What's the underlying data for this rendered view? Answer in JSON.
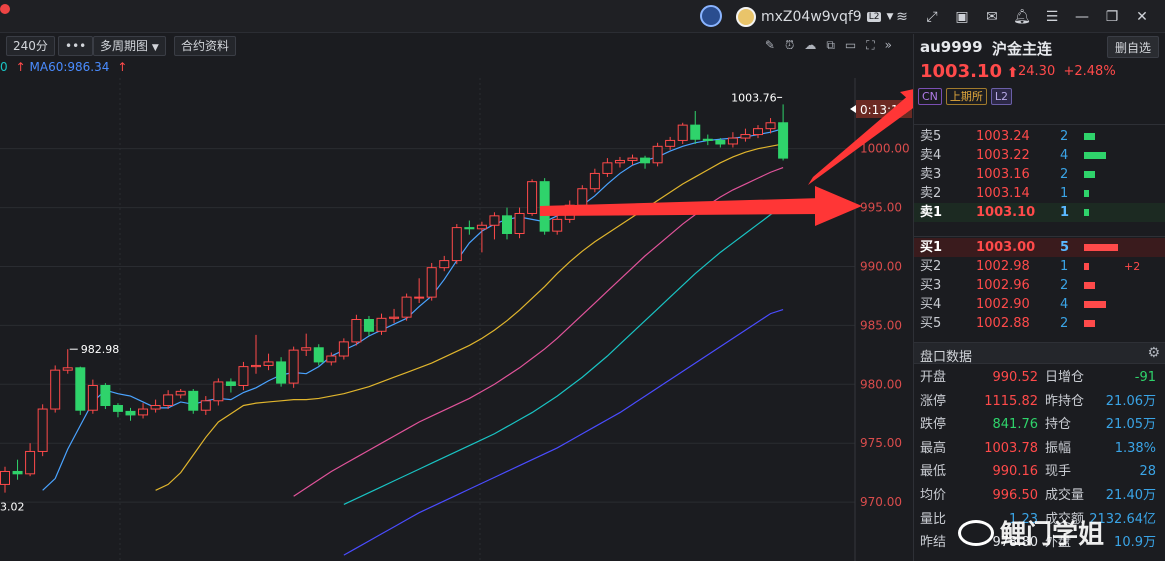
{
  "topbar": {
    "username": "mxZ04w9vqf9",
    "level_badge": "L2",
    "icons": [
      "robot-icon",
      "layers-icon",
      "expand-icon",
      "ticket-icon",
      "mail-icon",
      "bell-icon",
      "menu-icon",
      "minimize-icon",
      "restore-icon",
      "close-icon"
    ]
  },
  "toolbar": {
    "period": "240分",
    "more": "•••",
    "multi_period": "多周期图",
    "contract_info": "合约资料"
  },
  "ma_legend": {
    "ma60": "MA60:986.34"
  },
  "chart_data": {
    "type": "candlestick",
    "y_ticks": [
      "1000.00",
      "995.00",
      "990.00",
      "985.00",
      "980.00",
      "975.00",
      "970.00"
    ],
    "ylim": [
      965,
      1006
    ],
    "high_label": "1003.76",
    "low_label": "982.98",
    "left_low_label": "3.02",
    "countdown": "0:13:11",
    "candles": [
      [
        971.5,
        972.6,
        970.8,
        973.0
      ],
      [
        972.6,
        972.4,
        971.9,
        973.6
      ],
      [
        972.4,
        974.3,
        972.2,
        975.0
      ],
      [
        974.3,
        977.9,
        973.9,
        978.3
      ],
      [
        977.9,
        981.2,
        977.6,
        981.6
      ],
      [
        981.2,
        981.4,
        980.9,
        982.98
      ],
      [
        981.4,
        977.8,
        977.4,
        981.5
      ],
      [
        977.8,
        979.9,
        977.5,
        980.4
      ],
      [
        979.9,
        978.2,
        977.9,
        980.1
      ],
      [
        978.2,
        977.7,
        977.2,
        978.4
      ],
      [
        977.7,
        977.4,
        976.9,
        978.0
      ],
      [
        977.4,
        977.9,
        977.1,
        978.4
      ],
      [
        977.9,
        978.2,
        977.6,
        978.7
      ],
      [
        978.2,
        979.1,
        977.9,
        979.5
      ],
      [
        979.1,
        979.4,
        978.8,
        979.6
      ],
      [
        979.4,
        977.8,
        977.5,
        979.6
      ],
      [
        977.8,
        978.6,
        977.4,
        979.0
      ],
      [
        978.6,
        980.2,
        978.2,
        980.5
      ],
      [
        980.2,
        979.9,
        979.3,
        980.5
      ],
      [
        979.9,
        981.5,
        979.5,
        981.9
      ],
      [
        981.5,
        981.6,
        980.9,
        984.2
      ],
      [
        981.6,
        981.9,
        981.2,
        982.6
      ],
      [
        981.9,
        980.1,
        979.8,
        982.3
      ],
      [
        980.1,
        982.9,
        979.7,
        983.2
      ],
      [
        982.9,
        983.1,
        982.4,
        984.3
      ],
      [
        983.1,
        981.9,
        981.6,
        983.4
      ],
      [
        981.9,
        982.4,
        981.6,
        982.7
      ],
      [
        982.4,
        983.6,
        982.1,
        983.9
      ],
      [
        983.6,
        985.5,
        983.3,
        985.9
      ],
      [
        985.5,
        984.5,
        984.1,
        985.8
      ],
      [
        984.5,
        985.6,
        984.2,
        986.0
      ],
      [
        985.6,
        985.7,
        985.2,
        986.4
      ],
      [
        985.7,
        987.4,
        985.4,
        987.7
      ],
      [
        987.4,
        987.4,
        986.9,
        989.0
      ],
      [
        987.4,
        989.9,
        987.1,
        990.3
      ],
      [
        989.9,
        990.5,
        989.6,
        990.9
      ],
      [
        990.5,
        993.3,
        990.2,
        993.6
      ],
      [
        993.3,
        993.2,
        992.7,
        993.9
      ],
      [
        993.2,
        993.5,
        991.2,
        993.8
      ],
      [
        993.5,
        994.3,
        992.3,
        994.6
      ],
      [
        994.3,
        992.8,
        992.3,
        995.0
      ],
      [
        992.8,
        994.5,
        992.4,
        995.0
      ],
      [
        994.5,
        997.2,
        994.3,
        997.4
      ],
      [
        997.2,
        993.0,
        992.7,
        997.5
      ],
      [
        993.0,
        994.0,
        992.7,
        994.3
      ],
      [
        994.0,
        995.2,
        993.7,
        995.6
      ],
      [
        995.2,
        996.6,
        994.9,
        996.9
      ],
      [
        996.6,
        997.9,
        996.3,
        998.3
      ],
      [
        997.9,
        998.8,
        997.6,
        999.2
      ],
      [
        998.8,
        999.0,
        998.4,
        999.3
      ],
      [
        999.0,
        999.2,
        998.6,
        999.5
      ],
      [
        999.2,
        998.8,
        998.3,
        999.4
      ],
      [
        998.8,
        1000.2,
        998.5,
        1000.5
      ],
      [
        1000.2,
        1000.7,
        999.9,
        1001.0
      ],
      [
        1000.7,
        1002.0,
        1000.4,
        1002.2
      ],
      [
        1002.0,
        1000.8,
        1000.4,
        1003.2
      ],
      [
        1000.8,
        1000.7,
        1000.3,
        1001.2
      ],
      [
        1000.7,
        1000.4,
        1000.1,
        1000.9
      ],
      [
        1000.4,
        1000.9,
        1000.1,
        1001.4
      ],
      [
        1000.9,
        1001.2,
        1000.6,
        1001.7
      ],
      [
        1001.2,
        1001.7,
        1000.9,
        1002.0
      ],
      [
        1001.7,
        1002.2,
        1001.3,
        1002.6
      ],
      [
        1002.2,
        999.2,
        999.0,
        1003.76
      ]
    ],
    "ma_lines": [
      {
        "name": "MA5",
        "color": "#4aa3ff",
        "values": [
          971.0,
          972.0,
          974.5,
          976.5,
          978.5,
          979.5,
          979.2,
          979.0,
          978.5,
          978.0,
          978.0,
          978.5,
          978.3,
          978.6,
          978.8,
          978.7,
          979.3,
          979.7,
          980.3,
          980.8,
          981.0,
          980.9,
          981.5,
          982.4,
          982.9,
          983.4,
          984.1,
          984.6,
          985.1,
          985.6,
          986.6,
          987.5,
          988.9,
          990.5,
          992.0,
          993.0,
          993.6,
          994.0,
          994.2,
          994.0,
          993.8,
          994.3,
          994.9,
          995.2,
          996.0,
          997.0,
          997.9,
          998.6,
          999.0,
          999.3,
          999.8,
          1000.2,
          1000.5,
          1000.7,
          1000.8,
          1000.9,
          1001.0,
          1001.2,
          1001.4,
          1001.7
        ]
      },
      {
        "name": "MA10",
        "color": "#e0b52d",
        "values": [
          971.0,
          971.5,
          972.5,
          974.0,
          975.5,
          976.8,
          977.5,
          978.2,
          978.4,
          978.5,
          978.6,
          978.7,
          978.7,
          978.8,
          979.0,
          979.2,
          979.5,
          979.8,
          980.2,
          980.6,
          981.0,
          981.4,
          981.8,
          982.3,
          982.8,
          983.3,
          983.9,
          984.6,
          985.4,
          986.3,
          987.3,
          988.3,
          989.4,
          990.4,
          991.3,
          992.1,
          992.8,
          993.5,
          994.2,
          994.9,
          995.6,
          996.3,
          997.0,
          997.6,
          998.2,
          998.8,
          999.3,
          999.7,
          1000.0,
          1000.2,
          1000.4
        ]
      },
      {
        "name": "MA20",
        "color": "#e0539a",
        "values": [
          970.5,
          971.2,
          971.9,
          972.6,
          973.2,
          973.8,
          974.4,
          975.0,
          975.6,
          976.2,
          976.8,
          977.3,
          977.8,
          978.3,
          978.8,
          979.4,
          980.0,
          980.7,
          981.4,
          982.2,
          983.0,
          983.9,
          984.9,
          985.9,
          986.9,
          987.9,
          988.9,
          989.9,
          990.9,
          991.8,
          992.7,
          993.6,
          994.4,
          995.2,
          995.9,
          996.5,
          997.0,
          997.5,
          998.0,
          998.4
        ]
      },
      {
        "name": "MA40",
        "color": "#19c3c3",
        "values": [
          969.8,
          970.3,
          970.8,
          971.3,
          971.8,
          972.3,
          972.8,
          973.3,
          973.8,
          974.3,
          974.8,
          975.3,
          975.8,
          976.4,
          977.0,
          977.6,
          978.3,
          979.0,
          979.8,
          980.6,
          981.5,
          982.4,
          983.4,
          984.4,
          985.4,
          986.4,
          987.4,
          988.4,
          989.4,
          990.3,
          991.2,
          992.0,
          992.8,
          993.6,
          994.4,
          995.1
        ]
      },
      {
        "name": "MA60",
        "color": "#4a4cff",
        "values": [
          965.5,
          966.1,
          966.7,
          967.3,
          967.9,
          968.5,
          969.1,
          969.6,
          970.1,
          970.6,
          971.1,
          971.6,
          972.1,
          972.6,
          973.1,
          973.6,
          974.1,
          974.6,
          975.2,
          975.8,
          976.4,
          977.0,
          977.6,
          978.3,
          979.0,
          979.7,
          980.4,
          981.1,
          981.8,
          982.5,
          983.2,
          983.9,
          984.6,
          985.3,
          986.0,
          986.34
        ]
      }
    ]
  },
  "quote": {
    "code": "au9999",
    "name": "沪金主连",
    "del_button": "删自选",
    "price": "1003.10",
    "change": "24.30",
    "change_pct": "+2.48%",
    "tags": [
      "CN",
      "上期所",
      "L2"
    ]
  },
  "orderbook": {
    "asks": [
      {
        "label": "卖5",
        "price": "1003.24",
        "vol": "2",
        "bar": 0.33
      },
      {
        "label": "卖4",
        "price": "1003.22",
        "vol": "4",
        "bar": 0.66
      },
      {
        "label": "卖3",
        "price": "1003.16",
        "vol": "2",
        "bar": 0.33
      },
      {
        "label": "卖2",
        "price": "1003.14",
        "vol": "1",
        "bar": 0.15
      },
      {
        "label": "卖1",
        "price": "1003.10",
        "vol": "1",
        "bar": 0.15
      }
    ],
    "bids": [
      {
        "label": "买1",
        "price": "1003.00",
        "vol": "5",
        "bar": 1.0,
        "extra": ""
      },
      {
        "label": "买2",
        "price": "1002.98",
        "vol": "1",
        "bar": 0.15,
        "extra": "+2"
      },
      {
        "label": "买3",
        "price": "1002.96",
        "vol": "2",
        "bar": 0.33,
        "extra": ""
      },
      {
        "label": "买4",
        "price": "1002.90",
        "vol": "4",
        "bar": 0.66,
        "extra": ""
      },
      {
        "label": "买5",
        "price": "1002.88",
        "vol": "2",
        "bar": 0.33,
        "extra": ""
      }
    ]
  },
  "panel": {
    "title": "盘口数据",
    "rows": [
      {
        "k1": "开盘",
        "v1": "990.52",
        "c1": "red",
        "k2": "日增仓",
        "v2": "-91",
        "c2": "green"
      },
      {
        "k1": "涨停",
        "v1": "1115.82",
        "c1": "red",
        "k2": "昨持仓",
        "v2": "21.06万",
        "c2": "blue"
      },
      {
        "k1": "跌停",
        "v1": "841.76",
        "c1": "green",
        "k2": "持仓",
        "v2": "21.05万",
        "c2": "blue"
      },
      {
        "k1": "最高",
        "v1": "1003.78",
        "c1": "red",
        "k2": "振幅",
        "v2": "1.38%",
        "c2": "blue"
      },
      {
        "k1": "最低",
        "v1": "990.16",
        "c1": "red",
        "k2": "现手",
        "v2": "28",
        "c2": "blue"
      },
      {
        "k1": "均价",
        "v1": "996.50",
        "c1": "red",
        "k2": "成交量",
        "v2": "21.40万",
        "c2": "blue"
      },
      {
        "k1": "量比",
        "v1": "1.23",
        "c1": "blue",
        "k2": "成交额",
        "v2": "2132.64亿",
        "c2": "blue"
      },
      {
        "k1": "昨结",
        "v1": "978.80",
        "c1": "white",
        "k2": "外盘",
        "v2": "10.9万",
        "c2": "blue"
      }
    ]
  },
  "watermark": "鲤门学姐",
  "colors": {
    "up": "#ff4a4a",
    "down": "#2fd36b",
    "accent": "#ff3b3b"
  }
}
